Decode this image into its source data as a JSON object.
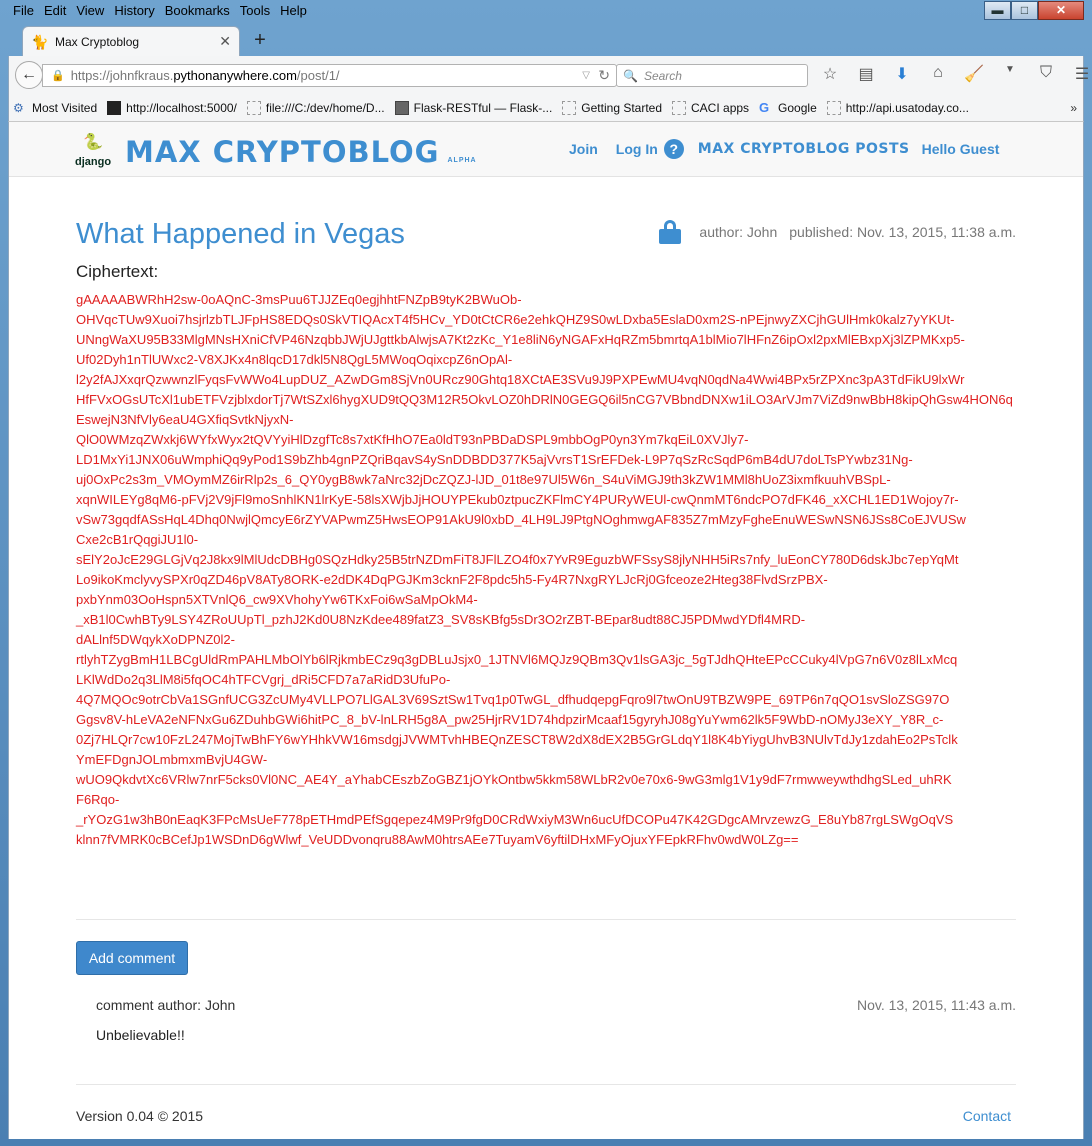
{
  "browser": {
    "menu": [
      "File",
      "Edit",
      "View",
      "History",
      "Bookmarks",
      "Tools",
      "Help"
    ],
    "window_controls": {
      "minimize": "▬",
      "maximize": "□",
      "close": "✕"
    },
    "tab": {
      "title": "Max Cryptoblog",
      "icon": "cat-icon"
    },
    "url": {
      "scheme_prefix": "https://johnfkraus.",
      "host": "pythonanywhere.com",
      "path": "/post/1/"
    },
    "search": {
      "placeholder": "Search"
    },
    "bookmarks": [
      {
        "label": "Most Visited",
        "icon": "most-visited-icon"
      },
      {
        "label": "http://localhost:5000/",
        "icon": "terminal-icon"
      },
      {
        "label": "file:///C:/dev/home/D...",
        "icon": "page-icon"
      },
      {
        "label": "Flask-RESTful — Flask-...",
        "icon": "book-icon"
      },
      {
        "label": "Getting Started",
        "icon": "page-icon"
      },
      {
        "label": "CACI apps",
        "icon": "page-icon"
      },
      {
        "label": "Google",
        "icon": "google-icon"
      },
      {
        "label": "http://api.usatoday.co...",
        "icon": "page-icon"
      }
    ]
  },
  "site": {
    "brand": "MAX CRYPTOBLOG",
    "alpha": "ALPHA",
    "django_label": "django",
    "nav": {
      "join": "Join",
      "login": "Log In",
      "help": "?",
      "posts": "MAX CRYPTOBLOG POSTS",
      "greeting": "Hello Guest"
    }
  },
  "post": {
    "title": "What Happened in Vegas",
    "author": "author: John",
    "published": "published: Nov. 13, 2015, 11:38 a.m.",
    "ciphertext_label": "Ciphertext:",
    "ciphertext_lines": [
      "gAAAAABWRhH2sw-0oAQnC-3msPuu6TJJZEq0egjhhtFNZpB9tyK2BWuOb-",
      "OHVqcTUw9Xuoi7hsjrlzbTLJFpHS8EDQs0SkVTIQAcxT4f5HCv_YD0tCtCR6e2ehkQHZ9S0wLDxba5EslaD0xm2S-nPEjnwyZXCjhGUlHmk0kalz7yYKUt-",
      "UNngWaXU95B33MlgMNsHXniCfVP46NzqbbJWjUJgttkbAlwjsA7Kt2zKc_Y1e8liN6yNGAFxHqRZm5bmrtqA1blMio7lHFnZ6ipOxl2pxMlEBxpXj3lZPMKxp5-",
      "Uf02Dyh1nTlUWxc2-V8XJKx4n8lqcD17dkl5N8QgL5MWoqOqixcpZ6nOpAl-",
      "l2y2fAJXxqrQzwwnzlFyqsFvWWo4LupDUZ_AZwDGm8SjVn0URcz90Ghtq18XCtAE3SVu9J9PXPEwMU4vqN0qdNa4Wwi4BPx5rZPXnc3pA3TdFikU9lxWr",
      "HfFVxOGsUTcXl1ubETFVzjblxdorTj7WtSZxl6hygXUD9tQQ3M12R5OkvLOZ0hDRlN0GEGQ6il5nCG7VBbndDNXw1iLO3ArVJm7ViZd9nwBbH8kipQhGsw4HON6qEswejN3NfVly6eaU4GXfiqSvtkNjyxN-",
      "QlO0WMzqZWxkj6WYfxWyx2tQVYyiHlDzgfTc8s7xtKfHhO7Ea0ldT93nPBDaDSPL9mbbOgP0yn3Ym7kqEiL0XVJly7-",
      "LD1MxYi1JNX06uWmphiQq9yPod1S9bZhb4gnPZQriBqavS4ySnDDBDD377K5ajVvrsT1SrEFDek-L9P7qSzRcSqdP6mB4dU7doLTsPYwbz31Ng-",
      "uj0OxPc2s3m_VMOymMZ6irRlp2s_6_QY0ygB8wk7aNrc32jDcZQZJ-lJD_01t8e97Ul5W6n_S4uViMGJ9th3kZW1MMl8hUoZ3ixmfkuuhVBSpL-",
      "xqnWILEYg8qM6-pFVj2V9jFl9moSnhlKN1lrKyE-58lsXWjbJjHOUYPEkub0ztpucZKFlmCY4PURyWEUl-cwQnmMT6ndcPO7dFK46_xXCHL1ED1Wojoy7r-",
      "vSw73gqdfASsHqL4Dhq0NwjlQmcyE6rZYVAPwmZ5HwsEOP91AkU9l0xbD_4LH9LJ9PtgNOghmwgAF835Z7mMzyFgheEnuWESwNSN6JSs8CoEJVUSw",
      "Cxe2cB1rQqgiJU1l0-",
      "sElY2oJcE29GLGjVq2J8kx9lMlUdcDBHg0SQzHdky25B5trNZDmFiT8JFlLZO4f0x7YvR9EguzbWFSsyS8jlyNHH5iRs7nfy_luEonCY780D6dskJbc7epYqMt",
      "Lo9ikoKmclyvySPXr0qZD46pV8ATy8ORK-e2dDK4DqPGJKm3cknF2F8pdc5h5-Fy4R7NxgRYLJcRj0Gfceoze2Hteg38FlvdSrzPBX-",
      "pxbYnm03OoHspn5XTVnlQ6_cw9XVhohyYw6TKxFoi6wSaMpOkM4-",
      "_xB1l0CwhBTy9LSY4ZRoUUpTl_pzhJ2Kd0U8NzKdee489fatZ3_SV8sKBfg5sDr3O2rZBT-BEpar8udt88CJ5PDMwdYDfl4MRD-",
      "dALlnf5DWqykXoDPNZ0l2-",
      "rtlyhTZygBmH1LBCgUldRmPAHLMbOlYb6lRjkmbECz9q3gDBLuJsjx0_1JTNVl6MQJz9QBm3Qv1lsGA3jc_5gTJdhQHteEPcCCuky4lVpG7n6V0z8lLxMcq",
      "LKlWdDo2q3LlM8i5fqOC4hTFCVgrj_dRi5CFD7a7aRidD3UfuPo-",
      "4Q7MQOc9otrCbVa1SGnfUCG3ZcUMy4VLLPO7LlGAL3V69SztSw1Tvq1p0TwGL_dfhudqepgFqro9l7twOnU9TBZW9PE_69TP6n7qQO1svSloZSG97O",
      "Ggsv8V-hLeVA2eNFNxGu6ZDuhbGWi6hitPC_8_bV-lnLRH5g8A_pw25HjrRV1D74hdpzirMcaaf15gyryhJ08gYuYwm62lk5F9WbD-nOMyJ3eXY_Y8R_c-",
      "0Zj7HLQr7cw10FzL247MojTwBhFY6wYHhkVW16msdgjJVWMTvhHBEQnZESCT8W2dX8dEX2B5GrGLdqY1l8K4bYiygUhvB3NUlvTdJy1zdahEo2PsTclk",
      "YmEFDgnJOLmbmxmBvjU4GW-",
      "wUO9QkdvtXc6VRlw7nrF5cks0Vl0NC_AE4Y_aYhabCEszbZoGBZ1jOYkOntbw5kkm58WLbR2v0e70x6-9wG3mlg1V1y9dF7rmwweywthdhgSLed_uhRK",
      "F6Rqo-",
      "_rYOzG1w3hB0nEaqK3FPcMsUeF778pETHmdPEfSgqepez4M9Pr9fgD0CRdWxiyM3Wn6ucUfDCOPu47K42GDgcAMrvzewzG_E8uYb87rgLSWgOqVS",
      "klnn7fVMRK0cBCefJp1WSDnD6gWlwf_VeUDDvonqru88AwM0htrsAEe7TuyamV6yftilDHxMFyOjuxYFEpkRFhv0wdW0LZg=="
    ]
  },
  "comments": {
    "add_button": "Add comment",
    "items": [
      {
        "author": "comment author: John",
        "date": "Nov. 13, 2015, 11:43 a.m.",
        "body": "Unbelievable!!"
      }
    ]
  },
  "footer": {
    "version": "Version 0.04 © 2015",
    "contact": "Contact"
  }
}
